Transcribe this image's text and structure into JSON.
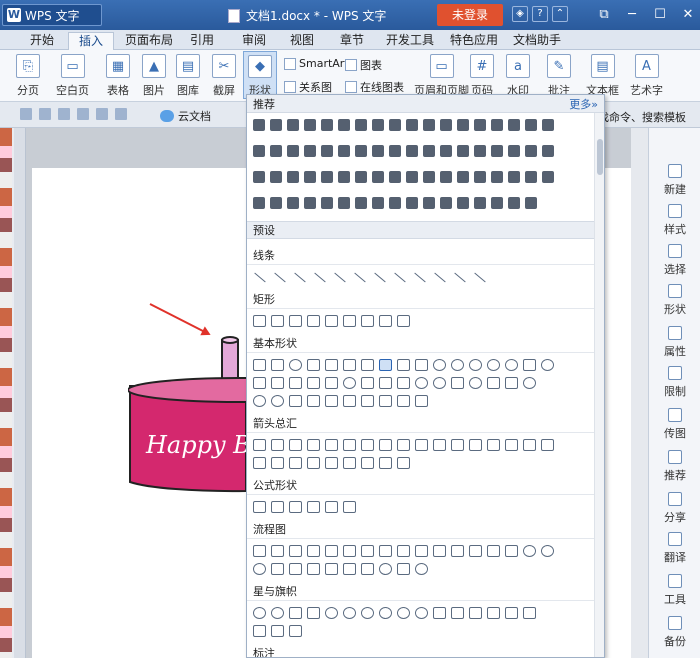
{
  "titlebar": {
    "app_name": "WPS 文字",
    "document_title": "文档1.docx * - WPS 文字",
    "login_label": "未登录"
  },
  "menu": {
    "tabs": [
      "开始",
      "插入",
      "页面布局",
      "引用",
      "审阅",
      "视图",
      "章节",
      "开发工具",
      "特色应用",
      "文档助手"
    ]
  },
  "ribbon": {
    "paging": "分页",
    "blank_page": "空白页",
    "table": "表格",
    "picture": "图片",
    "gallery": "图库",
    "screenshot": "截屏",
    "shapes": "形状",
    "smartart": "SmartArt",
    "chart": "图表",
    "relation": "关系图",
    "online_chart": "在线图表",
    "header_footer": "页眉和页脚",
    "page_number": "页码",
    "watermark": "水印",
    "comment": "批注",
    "textbox": "文本框",
    "wordart": "艺术字"
  },
  "quickbar": {
    "cloud_doc": "云文档",
    "search_hint": "找命令、搜索模板"
  },
  "dropdown": {
    "recommend": "推荐",
    "more": "更多»",
    "preset": "预设",
    "categories": {
      "lines": "线条",
      "rectangle": "矩形",
      "basic": "基本形状",
      "arrows": "箭头总汇",
      "formula": "公式形状",
      "flowchart": "流程图",
      "stars": "星与旗帜",
      "callouts": "标注"
    }
  },
  "document": {
    "cake_text": "Happy B"
  },
  "sidepanel": {
    "items": [
      "新建",
      "样式",
      "选择",
      "形状",
      "属性",
      "限制",
      "传图",
      "推荐",
      "分享",
      "翻译",
      "工具",
      "备份"
    ]
  },
  "colors": {
    "titlebar": "#2a5a9c",
    "accent": "#e0512f",
    "cake": "#d4286e",
    "candle": "#e4a8d8"
  }
}
